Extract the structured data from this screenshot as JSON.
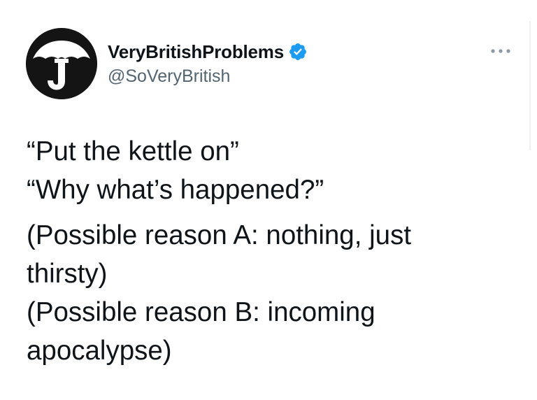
{
  "tweet": {
    "author": {
      "display_name": "VeryBritishProblems",
      "handle": "@SoVeryBritish",
      "verified": true,
      "avatar_icon": "umbrella-j-logo",
      "avatar_color": "#141414"
    },
    "more_icon": "more-horizontal-icon",
    "verified_icon": "verified-badge-icon",
    "verified_color": "#1d9bf0",
    "text_lines": [
      "“Put the kettle on”",
      "“Why what’s happened?”",
      "(Possible reason A: nothing, just",
      "thirsty)",
      "(Possible reason B: incoming",
      "apocalypse)"
    ]
  }
}
